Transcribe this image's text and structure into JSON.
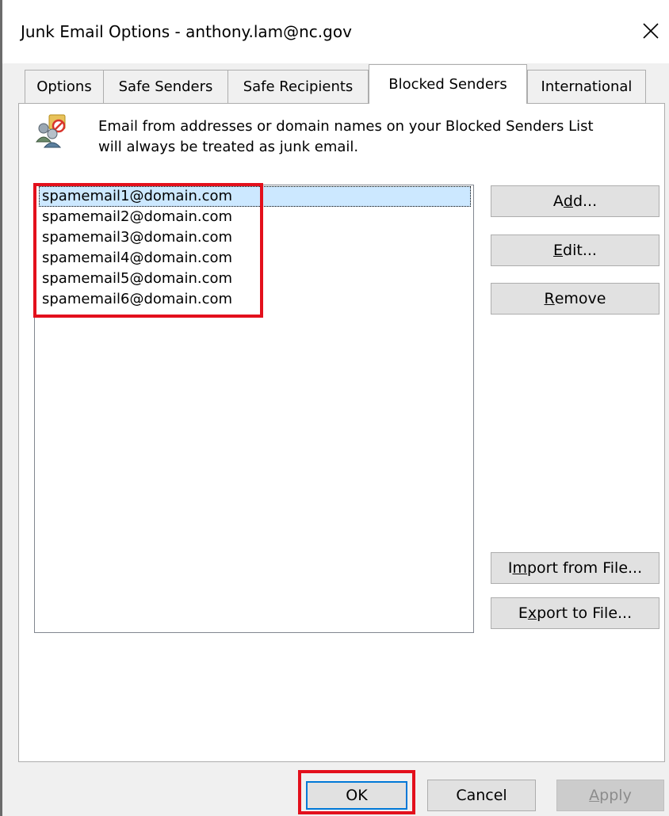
{
  "window": {
    "title": "Junk Email Options - anthony.lam@nc.gov",
    "close_icon": "close-icon"
  },
  "tabs": [
    {
      "label": "Options",
      "active": false
    },
    {
      "label": "Safe Senders",
      "active": false
    },
    {
      "label": "Safe Recipients",
      "active": false
    },
    {
      "label": "Blocked Senders",
      "active": true
    },
    {
      "label": "International",
      "active": false
    }
  ],
  "info": {
    "icon": "blocked-users-icon",
    "line1": "Email from addresses or domain names on your Blocked Senders List",
    "line2": "will always be treated as junk email."
  },
  "blocked_list": [
    "spamemail1@domain.com",
    "spamemail2@domain.com",
    "spamemail3@domain.com",
    "spamemail4@domain.com",
    "spamemail5@domain.com",
    "spamemail6@domain.com"
  ],
  "selected_index": 0,
  "buttons": {
    "add": {
      "pre": "A",
      "mnemonic": "d",
      "post": "d..."
    },
    "edit": {
      "pre": "",
      "mnemonic": "E",
      "post": "dit..."
    },
    "remove": {
      "pre": "",
      "mnemonic": "R",
      "post": "emove"
    },
    "import": {
      "pre": "I",
      "mnemonic": "m",
      "post": "port from File..."
    },
    "export": {
      "pre": "E",
      "mnemonic": "x",
      "post": "port to File..."
    }
  },
  "footer": {
    "ok": "OK",
    "cancel": "Cancel",
    "apply": {
      "pre": "",
      "mnemonic": "A",
      "post": "pply"
    }
  },
  "colors": {
    "highlight_box": "#e3101c",
    "selection": "#cce8ff",
    "default_button_border": "#0078d7"
  }
}
